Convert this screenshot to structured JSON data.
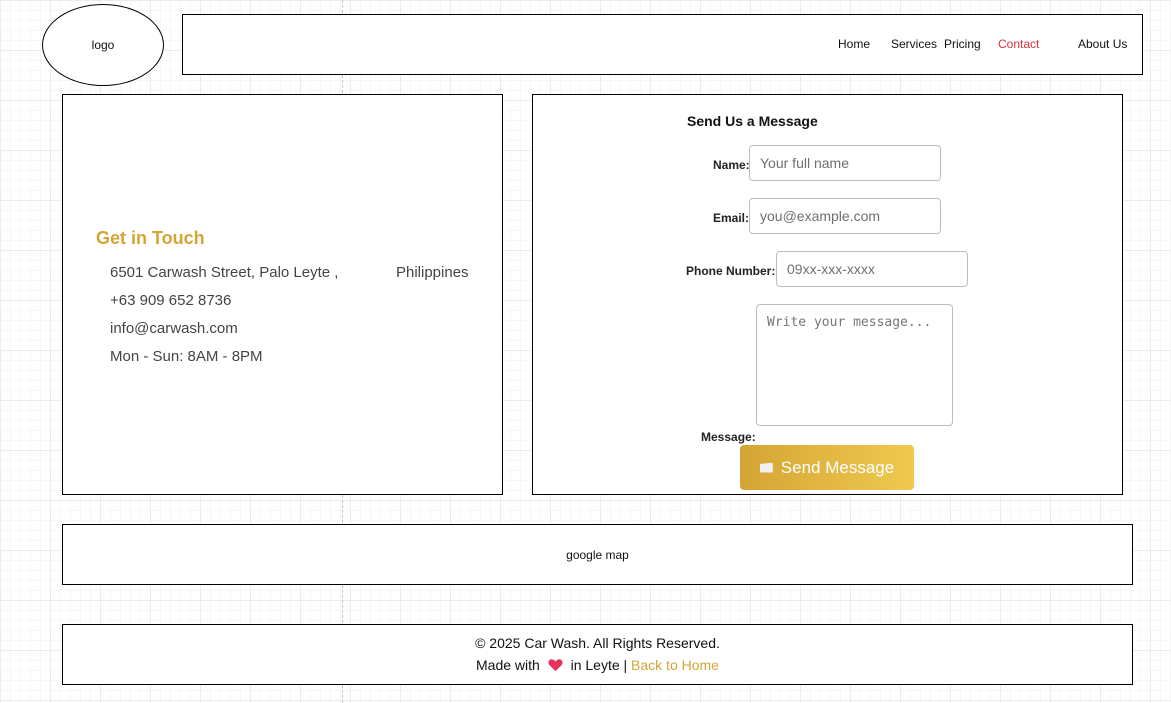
{
  "header": {
    "logo_text": "logo",
    "nav": [
      {
        "label": "Home"
      },
      {
        "label": "Services"
      },
      {
        "label": "Pricing"
      },
      {
        "label": "Contact",
        "active": true
      },
      {
        "label": "About Us"
      }
    ],
    "active_color": "#e0303a"
  },
  "info": {
    "title": "Get in Touch",
    "address": "6501 Carwash Street, Palo Leyte ,",
    "country": "Philippines",
    "phone": "+63 909 652 8736",
    "email": "info@carwash.com",
    "hours": "Mon - Sun: 8AM - 8PM",
    "accent_color": "#d4a535"
  },
  "form": {
    "title": "Send Us a Message",
    "name_label": "Name:",
    "name_placeholder": "Your full name",
    "email_label": "Email:",
    "email_placeholder": "you@example.com",
    "phone_label": "Phone Number:",
    "phone_placeholder": "09xx-xxx-xxxx",
    "message_label": "Message:",
    "message_placeholder": "Write your message...",
    "submit_label": "Send Message",
    "submit_icon": "envelope-icon"
  },
  "map": {
    "label": "google map"
  },
  "footer": {
    "copyright": "© 2025 Car Wash. All Rights Reserved.",
    "made_with": "Made with",
    "heart_icon": "heart-icon",
    "location": "in Leyte |",
    "back_link": "Back to Home"
  }
}
